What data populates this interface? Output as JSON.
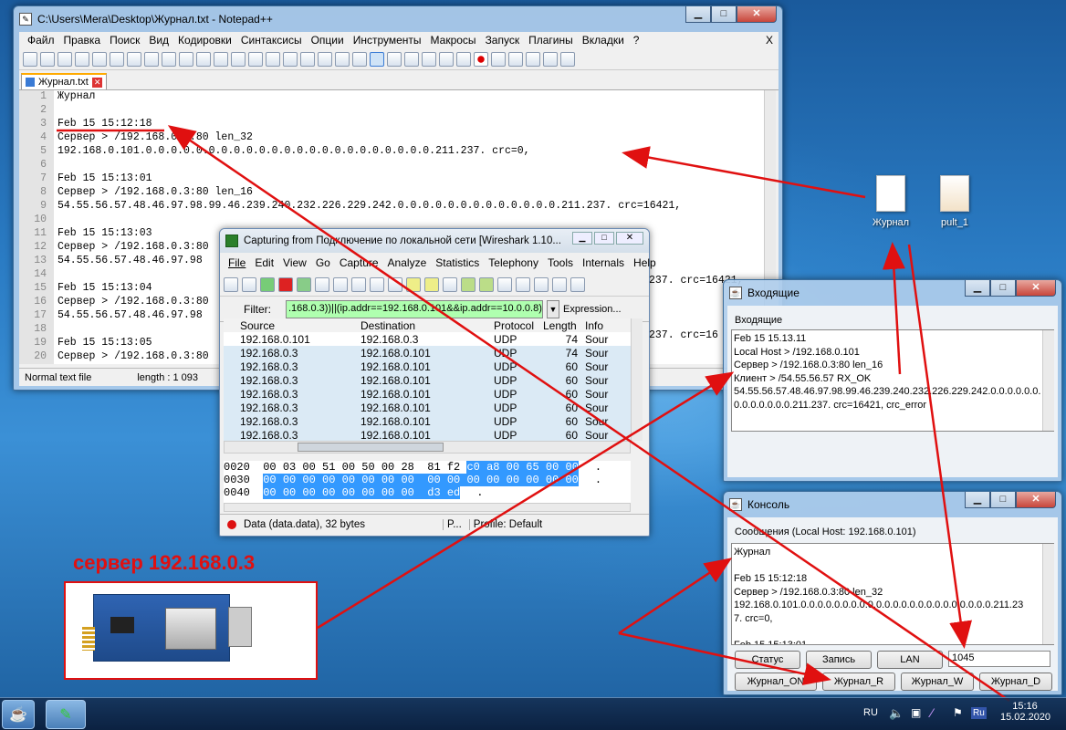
{
  "npp": {
    "title": "C:\\Users\\Mera\\Desktop\\Журнал.txt - Notepad++",
    "menu": [
      "Файл",
      "Правка",
      "Поиск",
      "Вид",
      "Кодировки",
      "Синтаксисы",
      "Опции",
      "Инструменты",
      "Макросы",
      "Запуск",
      "Плагины",
      "Вкладки",
      "?"
    ],
    "close_x": "X",
    "tab": "Журнал.txt",
    "lines": [
      "Журнал",
      "",
      "Feb 15 15:12:18",
      "Сервер > /192.168.0.3:80 len_32",
      "192.168.0.101.0.0.0.0.0.0.0.0.0.0.0.0.0.0.0.0.0.0.0.0.0.0.0.211.237. crc=0,",
      "",
      "Feb 15 15:13:01",
      "Сервер > /192.168.0.3:80 len_16",
      "54.55.56.57.48.46.97.98.99.46.239.240.232.226.229.242.0.0.0.0.0.0.0.0.0.0.0.0.0.211.237. crc=16421,",
      "",
      "Feb 15 15:13:03",
      "Сервер > /192.168.0.3:80",
      "54.55.56.57.48.46.97.98",
      "",
      "Feb 15 15:13:04",
      "Сервер > /192.168.0.3:80",
      "54.55.56.57.48.46.97.98",
      "",
      "Feb 15 15:13:05",
      "Сервер > /192.168.0.3:80"
    ],
    "right_tail_13": "237. crc=16421,",
    "right_tail_17": "237. crc=16",
    "status_type": "Normal text file",
    "status_length": "length : 1 093",
    "status_encoding": "ndows-1251"
  },
  "ws": {
    "title": "Capturing from Подключение по локальной сети   [Wireshark 1.10...",
    "menu": [
      "File",
      "Edit",
      "View",
      "Go",
      "Capture",
      "Analyze",
      "Statistics",
      "Telephony",
      "Tools",
      "Internals",
      "Help"
    ],
    "filter_label": "Filter:",
    "filter_value": ".168.0.3))||(ip.addr==192.168.0.101&&ip.addr==10.0.0.8)",
    "expression": "Expression...",
    "columns": [
      "Source",
      "Destination",
      "Protocol",
      "Length",
      "Info"
    ],
    "rows": [
      [
        "192.168.0.101",
        "192.168.0.3",
        "UDP",
        "74",
        "Sour"
      ],
      [
        "192.168.0.3",
        "192.168.0.101",
        "UDP",
        "74",
        "Sour"
      ],
      [
        "192.168.0.3",
        "192.168.0.101",
        "UDP",
        "60",
        "Sour"
      ],
      [
        "192.168.0.3",
        "192.168.0.101",
        "UDP",
        "60",
        "Sour"
      ],
      [
        "192.168.0.3",
        "192.168.0.101",
        "UDP",
        "60",
        "Sour"
      ],
      [
        "192.168.0.3",
        "192.168.0.101",
        "UDP",
        "60",
        "Sour"
      ],
      [
        "192.168.0.3",
        "192.168.0.101",
        "UDP",
        "60",
        "Sour"
      ],
      [
        "192.168.0.3",
        "192.168.0.101",
        "UDP",
        "60",
        "Sour"
      ]
    ],
    "hex": [
      {
        "off": "0020",
        "plain": "00 03 00 51 00 50 00 28  81 f2 ",
        "hl": "c0 a8 00 65 00 00",
        "tail": "."
      },
      {
        "off": "0030",
        "plain": "",
        "hl": "00 00 00 00 00 00 00 00  00 00 00 00 00 00 00 00",
        "tail": "."
      },
      {
        "off": "0040",
        "plain": "",
        "hl": "00 00 00 00 00 00 00 00  d3 ed",
        "tail": "."
      }
    ],
    "status_data": "Data (data.data), 32 bytes",
    "status_p": "P...",
    "status_profile": "Profile: Default"
  },
  "incoming": {
    "title": "Входящие",
    "group_label": "Входящие",
    "text": "Feb 15 15.13.11\nLocal Host > /192.168.0.101\nСервер > /192.168.0.3:80 len_16\nКлиент > /54.55.56.57 RX_OK\n54.55.56.57.48.46.97.98.99.46.239.240.232.226.229.242.0.0.0.0.0.0.\n0.0.0.0.0.0.0.211.237. crc=16421, crc_error"
  },
  "console": {
    "title": "Консоль",
    "group_label": "Сообщения (Local Host: 192.168.0.101)",
    "text": "Журнал\n\nFeb 15 15:12:18\nСервер > /192.168.0.3:80 len_32\n192.168.0.101.0.0.0.0.0.0.0.0.0.0.0.0.0.0.0.0.0.0.0.0.0.0.0.211.23\n7. crc=0,\n\nFeb 15 15:13:01",
    "buttons_row1": [
      "Статус",
      "Запись",
      "LAN"
    ],
    "port_value": "1045",
    "buttons_row2": [
      "Журнал_ON",
      "Журнал_R",
      "Журнал_W",
      "Журнал_D"
    ]
  },
  "desktop": {
    "icon1": "Журнал",
    "icon2": "pult_1",
    "server_label": "сервер 192.168.0.3"
  },
  "taskbar": {
    "lang": "RU",
    "time": "15:16",
    "date": "15.02.2020",
    "ru_badge": "Ru"
  },
  "colors": {
    "annotation": "#e01010",
    "selection": "#3399ff"
  }
}
